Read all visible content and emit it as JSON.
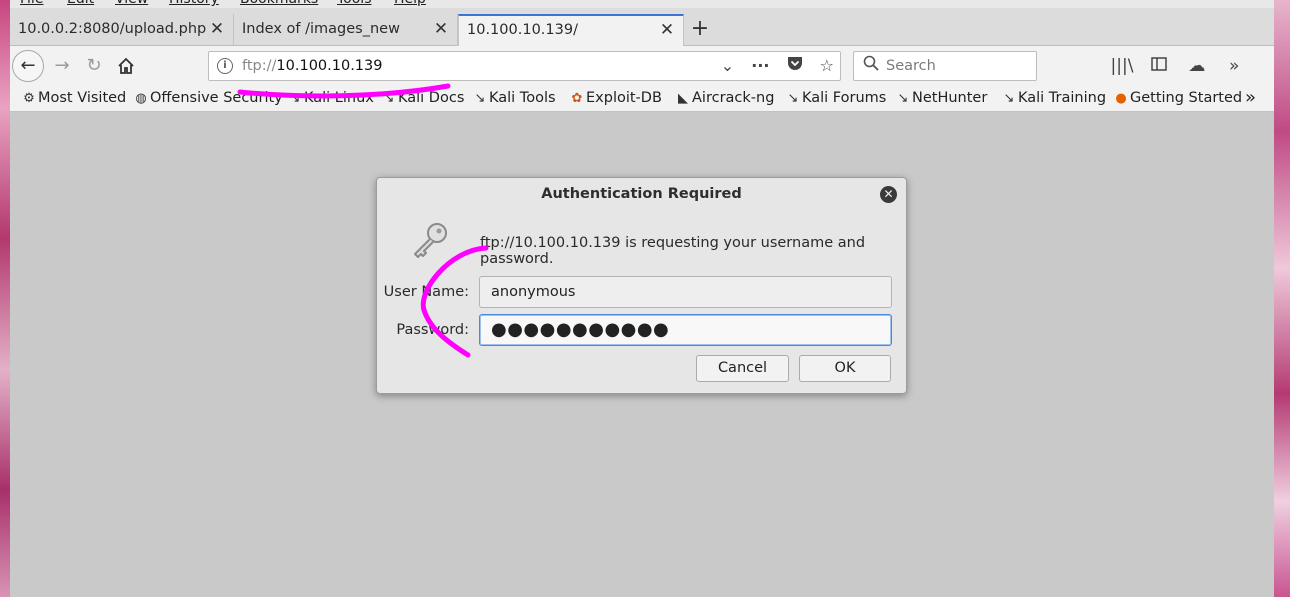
{
  "menu": [
    "File",
    "Edit",
    "View",
    "History",
    "Bookmarks",
    "Tools",
    "Help"
  ],
  "tabs": [
    {
      "title": "10.0.0.2:8080/upload.php"
    },
    {
      "title": "Index of /images_new"
    },
    {
      "title": "10.100.10.139/"
    }
  ],
  "tab_close_glyph": "✕",
  "newtab_glyph": "+",
  "navigation": {
    "url_scheme": "ftp://",
    "url_host": "10.100.10.139",
    "search_placeholder": "Search"
  },
  "bookmarks": [
    {
      "label": "Most Visited",
      "icon": "gear-icon"
    },
    {
      "label": "Offensive Security",
      "icon": "globe-icon"
    },
    {
      "label": "Kali Linux",
      "icon": "kali-icon"
    },
    {
      "label": "Kali Docs",
      "icon": "kali-icon"
    },
    {
      "label": "Kali Tools",
      "icon": "kali-icon"
    },
    {
      "label": "Exploit-DB",
      "icon": "exploit-db-icon"
    },
    {
      "label": "Aircrack-ng",
      "icon": "aircrack-icon"
    },
    {
      "label": "Kali Forums",
      "icon": "kali-icon"
    },
    {
      "label": "NetHunter",
      "icon": "kali-icon"
    },
    {
      "label": "Kali Training",
      "icon": "kali-icon"
    },
    {
      "label": "Getting Started",
      "icon": "firefox-icon"
    }
  ],
  "dialog": {
    "title": "Authentication Required",
    "message": "ftp://10.100.10.139 is requesting your username and password.",
    "username_label": "User Name:",
    "username_value": "anonymous",
    "password_label": "Password:",
    "password_value": "●●●●●●●●●●●",
    "cancel_label": "Cancel",
    "ok_label": "OK"
  },
  "colors": {
    "annotation": "#ff00ff",
    "focus_ring": "#4a8ad8",
    "active_tab_accent": "#3b74d6"
  }
}
